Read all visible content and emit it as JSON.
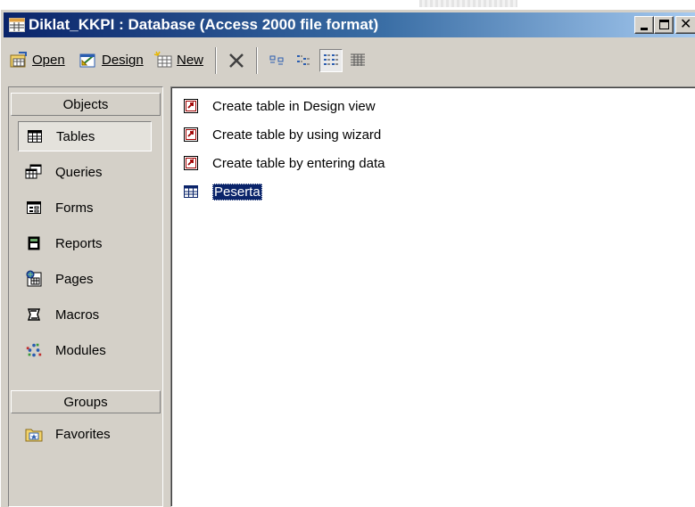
{
  "window": {
    "title": "Diklat_KKPI : Database (Access 2000 file format)",
    "minimize_icon": "minimize-icon",
    "maximize_icon": "maximize-icon",
    "close_icon": "close-icon",
    "close_glyph": "✕"
  },
  "toolbar": {
    "open_label": "Open",
    "open_mnemonic": "O",
    "design_label": "Design",
    "design_mnemonic": "D",
    "new_label": "New",
    "new_mnemonic": "N",
    "icons": [
      "open-icon",
      "design-icon",
      "new-icon",
      "delete-icon",
      "large-icons-view-icon",
      "small-icons-view-icon",
      "list-view-icon",
      "details-view-icon"
    ]
  },
  "sidebar": {
    "objects_header": "Objects",
    "groups_header": "Groups",
    "items": [
      {
        "label": "Tables",
        "icon": "table-icon",
        "selected": true
      },
      {
        "label": "Queries",
        "icon": "query-icon"
      },
      {
        "label": "Forms",
        "icon": "form-icon"
      },
      {
        "label": "Reports",
        "icon": "report-icon"
      },
      {
        "label": "Pages",
        "icon": "page-icon"
      },
      {
        "label": "Macros",
        "icon": "macro-icon"
      },
      {
        "label": "Modules",
        "icon": "module-icon"
      }
    ],
    "groups": [
      {
        "label": "Favorites",
        "icon": "favorites-folder-icon"
      }
    ]
  },
  "list": {
    "items": [
      {
        "label": "Create table in Design view",
        "icon": "shortcut-icon"
      },
      {
        "label": "Create table by using wizard",
        "icon": "shortcut-icon"
      },
      {
        "label": "Create table by entering data",
        "icon": "shortcut-icon"
      },
      {
        "label": "Peserta",
        "icon": "table-icon",
        "selected": true
      }
    ]
  },
  "colors": {
    "titlebar_start": "#0a246a",
    "titlebar_end": "#a6caf0",
    "face": "#d4d0c8",
    "selection": "#0a246a"
  }
}
